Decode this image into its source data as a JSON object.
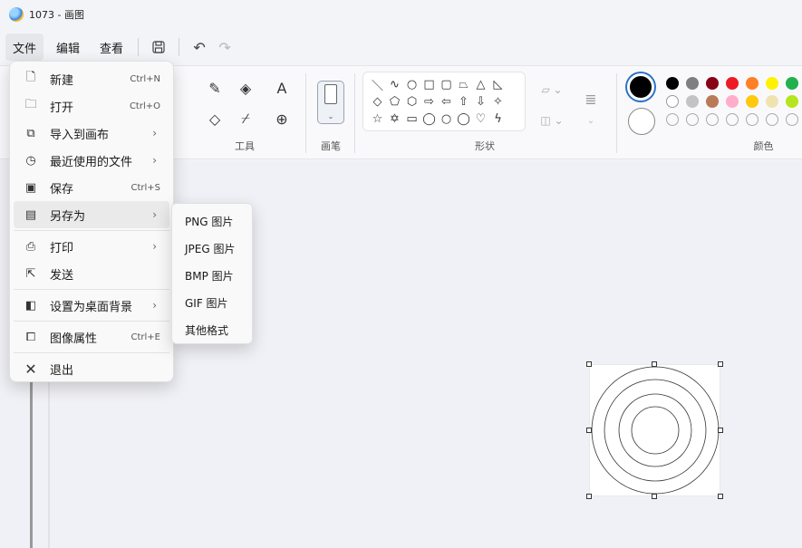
{
  "window": {
    "title": "1073 - 画图"
  },
  "menubar": {
    "file": "文件",
    "edit": "编辑",
    "view": "查看"
  },
  "quick_access": {
    "save_icon": "save-icon",
    "undo_icon": "undo-icon",
    "redo_icon": "redo-icon"
  },
  "ribbon": {
    "tools_label": "工具",
    "brush_label": "画笔",
    "shapes_label": "形状",
    "colors_label": "颜色",
    "text_tool": "A"
  },
  "colors": {
    "primary": "#000000",
    "secondary": "#ffffff",
    "palette_row1": [
      "#000000",
      "#7f7f7f",
      "#880015",
      "#ed1c24",
      "#ff7f27",
      "#fff200",
      "#22b14c"
    ],
    "palette_row2": [
      "#ffffff",
      "#c3c3c3",
      "#b97a57",
      "#ffaec9",
      "#ffc90e",
      "#efe4b0",
      "#b5e61d"
    ]
  },
  "file_menu": {
    "items": [
      {
        "label": "新建",
        "shortcut": "Ctrl+N",
        "icon": "new-file-icon"
      },
      {
        "label": "打开",
        "shortcut": "Ctrl+O",
        "icon": "folder-icon"
      },
      {
        "label": "导入到画布",
        "shortcut": "",
        "icon": "import-icon"
      },
      {
        "label": "最近使用的文件",
        "shortcut": "",
        "icon": "clock-icon"
      },
      {
        "label": "保存",
        "shortcut": "Ctrl+S",
        "icon": "save-icon"
      },
      {
        "label": "另存为",
        "shortcut": "",
        "icon": "save-as-icon"
      },
      {
        "label": "打印",
        "shortcut": "",
        "icon": "print-icon"
      },
      {
        "label": "发送",
        "shortcut": "",
        "icon": "share-icon"
      },
      {
        "label": "设置为桌面背景",
        "shortcut": "",
        "icon": "wallpaper-icon"
      },
      {
        "label": "图像属性",
        "shortcut": "Ctrl+E",
        "icon": "properties-icon"
      },
      {
        "label": "退出",
        "shortcut": "",
        "icon": "close-icon"
      }
    ]
  },
  "save_as_menu": {
    "items": [
      "PNG 图片",
      "JPEG 图片",
      "BMP 图片",
      "GIF 图片",
      "其他格式"
    ]
  }
}
